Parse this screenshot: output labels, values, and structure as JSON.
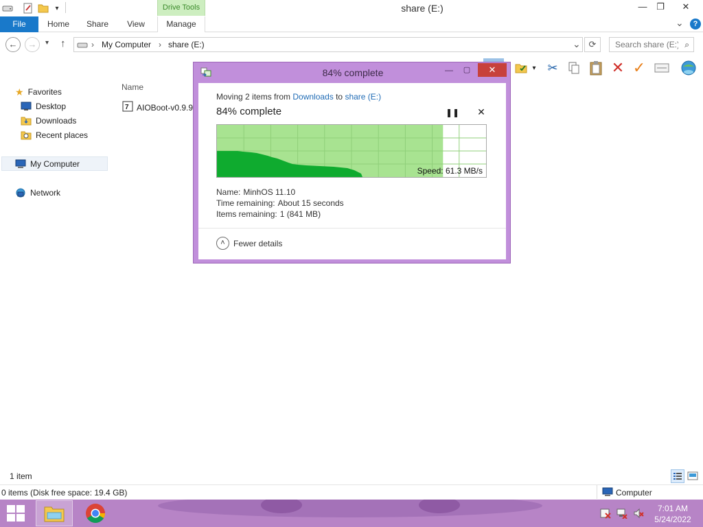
{
  "window": {
    "title": "share (E:)",
    "context_tab": "Drive Tools",
    "minimize_glyph": "—",
    "maximize_glyph": "❐",
    "close_glyph": "✕"
  },
  "ribbon": {
    "file": "File",
    "tabs": [
      "Home",
      "Share",
      "View",
      "Manage"
    ],
    "expand_glyph": "⌄",
    "help_glyph": "?"
  },
  "address_bar": {
    "back_glyph": "←",
    "forward_glyph": "→",
    "recent_glyph": "▾",
    "up_glyph": "↑",
    "crumbs": [
      "My Computer",
      "share (E:)"
    ],
    "crumb_separator": "›",
    "dropdown_glyph": "⌄",
    "refresh_glyph": "⟳",
    "search_placeholder": "Search share (E:)",
    "search_glyph": "⌕"
  },
  "nav_pane": {
    "favorites": "Favorites",
    "favorite_items": [
      "Desktop",
      "Downloads",
      "Recent places"
    ],
    "my_computer": "My Computer",
    "network": "Network"
  },
  "content": {
    "column_name": "Name",
    "file_name": "AIOBoot-v0.9.9."
  },
  "status": {
    "item_count": "1 item",
    "disk_info": "0 items (Disk free space: 19.4 GB)",
    "location": "Computer"
  },
  "taskbar": {
    "time": "7:01 AM",
    "date": "5/24/2022"
  },
  "dialog": {
    "title": "84% complete",
    "minimize_glyph": "—",
    "maximize_glyph": "▢",
    "close_glyph": "✕",
    "moving_prefix": "Moving 2 items from ",
    "source": "Downloads",
    "moving_mid": " to ",
    "destination": "share (E:)",
    "progress_text": "84% complete",
    "progress_fraction": 0.84,
    "pause_glyph": "❚❚",
    "cancel_glyph": "✕",
    "speed": "Speed: 61.3 MB/s",
    "name_label": "Name:",
    "name_value": "MinhOS 11.10",
    "time_label": "Time remaining:",
    "time_value": "About 15 seconds",
    "items_label": "Items remaining:",
    "items_value": "1 (841 MB)",
    "details_glyph": "˄",
    "fewer_details": "Fewer details"
  }
}
